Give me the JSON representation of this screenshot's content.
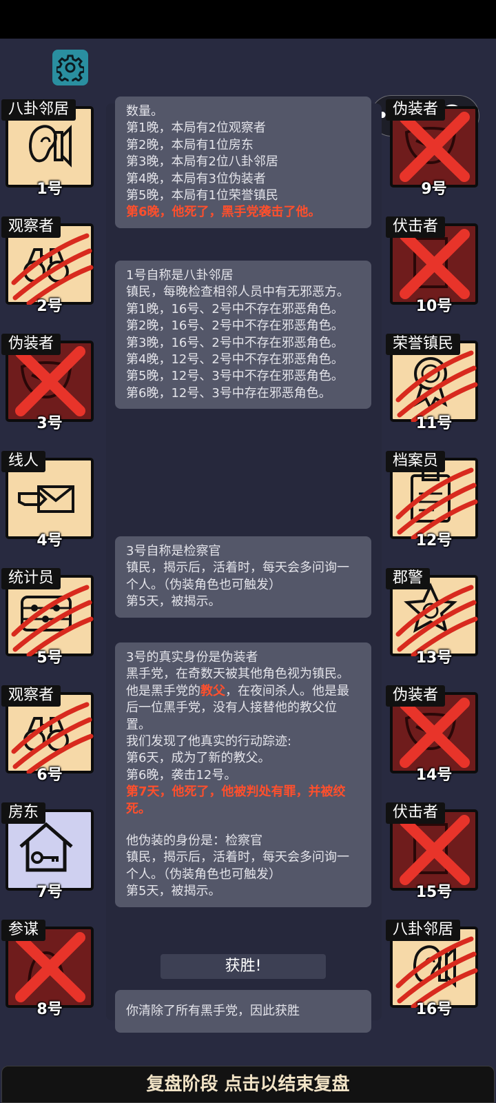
{
  "settings_icon": "gear-icon",
  "capsule": {
    "more_icon": "more-dots-icon",
    "close_icon": "target-close-icon"
  },
  "colors": {
    "background": "#282a40",
    "good_card": "#f6d9a8",
    "evil_card": "#6f1c1c",
    "accent_red": "#ff4f2c"
  },
  "left_players": [
    {
      "role": "八卦邻居",
      "number": "1号",
      "icon": "ear-speaker-icon",
      "mark": "none"
    },
    {
      "role": "观察者",
      "number": "2号",
      "icon": "binoculars-icon",
      "mark": "claw"
    },
    {
      "role": "伪装者",
      "number": "3号",
      "icon": "mask-icon",
      "mark": "cross"
    },
    {
      "role": "线人",
      "number": "4号",
      "icon": "hand-envelope-icon",
      "mark": "none"
    },
    {
      "role": "统计员",
      "number": "5号",
      "icon": "abacus-icon",
      "mark": "claw"
    },
    {
      "role": "观察者",
      "number": "6号",
      "icon": "binoculars-icon",
      "mark": "claw"
    },
    {
      "role": "房东",
      "number": "7号",
      "icon": "house-key-icon",
      "mark": "none"
    },
    {
      "role": "参谋",
      "number": "8号",
      "icon": "strategist-icon",
      "mark": "cross"
    }
  ],
  "right_players": [
    {
      "role": "伪装者",
      "number": "9号",
      "icon": "mask-icon",
      "mark": "cross"
    },
    {
      "role": "伏击者",
      "number": "10号",
      "icon": "door-icon",
      "mark": "cross"
    },
    {
      "role": "荣誉镇民",
      "number": "11号",
      "icon": "medal-icon",
      "mark": "claw"
    },
    {
      "role": "档案员",
      "number": "12号",
      "icon": "clipboard-icon",
      "mark": "claw"
    },
    {
      "role": "郡警",
      "number": "13号",
      "icon": "sheriff-star-icon",
      "mark": "claw"
    },
    {
      "role": "伪装者",
      "number": "14号",
      "icon": "mask-icon",
      "mark": "cross"
    },
    {
      "role": "伏击者",
      "number": "15号",
      "icon": "door-icon",
      "mark": "cross"
    },
    {
      "role": "八卦邻居",
      "number": "16号",
      "icon": "ear-speaker-icon",
      "mark": "claw"
    }
  ],
  "messages": {
    "m1": {
      "lines": [
        "数量。",
        "第1晚，本局有2位观察者",
        "第2晚，本局有1位房东",
        "第3晚，本局有2位八卦邻居",
        "第4晚，本局有3位伪装者",
        "第5晚，本局有1位荣誉镇民"
      ],
      "highlight": "第6晚，他死了，黑手党袭击了他。"
    },
    "m2": {
      "lines": [
        "1号自称是八卦邻居",
        "镇民，每晚检查相邻人员中有无邪恶方。",
        "第1晚，16号、2号中不存在邪恶角色。",
        "第2晚，16号、2号中不存在邪恶角色。",
        "第3晚，16号、2号中不存在邪恶角色。",
        "第4晚，12号、2号中不存在邪恶角色。",
        "第5晚，12号、3号中不存在邪恶角色。",
        "第6晚，12号、3号中存在邪恶角色。"
      ]
    },
    "m3": {
      "lines": [
        "3号自称是检察官",
        "镇民，揭示后，活着时，每天会多问询一个人。（伪装角色也可触发）",
        "第5天，被揭示。"
      ]
    },
    "m4": {
      "line1": "3号的真实身份是伪装者",
      "line2": "黑手党，在奇数天被其他角色视为镇民。",
      "line3_pre": "他是黑手党的",
      "line3_kw": "教父",
      "line3_post": "，在夜间杀人。他是最后一位黑手党，没有人接替他的教父位置。",
      "line4": "我们发现了他真实的行动踪迹:",
      "line5": "第6天，成为了新的教父。",
      "line6": "第6晚，袭击12号。",
      "highlight": "第7天，他死了，他被判处有罪，并被绞死。",
      "disguise_title": "他伪装的身份是：检察官",
      "disguise_desc": "镇民，揭示后，活着时，每天会多问询一个人。（伪装角色也可触发）",
      "disguise_day": "第5天，被揭示。"
    },
    "victory_label": "获胜!",
    "victory_text": "你清除了所有黑手党，因此获胜"
  },
  "bottom_bar": "复盘阶段 点击以结束复盘"
}
